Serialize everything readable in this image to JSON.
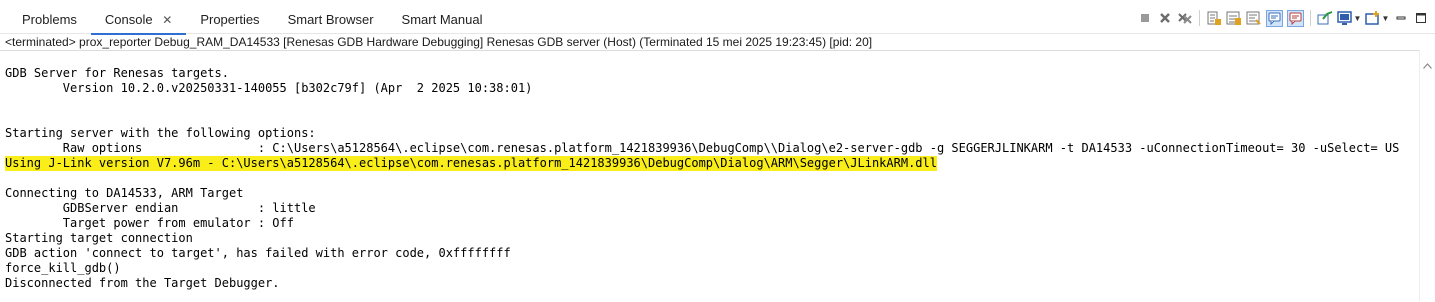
{
  "tabs": [
    {
      "label": "Problems"
    },
    {
      "label": "Console",
      "close": "✕"
    },
    {
      "label": "Properties"
    },
    {
      "label": "Smart Browser"
    },
    {
      "label": "Smart Manual"
    }
  ],
  "toolbar_icons": [
    "terminate-icon",
    "remove-launch-icon",
    "remove-all-terminated-icon",
    "show-console-stdout-icon",
    "scroll-lock-icon",
    "word-wrap-icon",
    "show-on-stdout-change-icon",
    "show-on-stderr-change-icon",
    "pin-console-icon",
    "display-selected-console-icon",
    "open-console-icon",
    "minimize-icon",
    "maximize-icon"
  ],
  "status": "<terminated> prox_reporter Debug_RAM_DA14533 [Renesas GDB Hardware Debugging] Renesas GDB server (Host) (Terminated 15 mei 2025 19:23:45) [pid: 20]",
  "console_lines": [
    {
      "text": "GDB Server for Renesas targets.",
      "highlight": false
    },
    {
      "text": "        Version 10.2.0.v20250331-140055 [b302c79f] (Apr  2 2025 10:38:01)",
      "highlight": false
    },
    {
      "text": "",
      "highlight": false
    },
    {
      "text": "",
      "highlight": false
    },
    {
      "text": "Starting server with the following options:",
      "highlight": false
    },
    {
      "text": "        Raw options                : C:\\Users\\a5128564\\.eclipse\\com.renesas.platform_1421839936\\DebugComp\\\\Dialog\\e2-server-gdb -g SEGGERJLINKARM -t DA14533 -uConnectionTimeout= 30 -uSelect= US",
      "highlight": false
    },
    {
      "text": "Using J-Link version V7.96m - C:\\Users\\a5128564\\.eclipse\\com.renesas.platform_1421839936\\DebugComp\\Dialog\\ARM\\Segger\\JLinkARM.dll",
      "highlight": true
    },
    {
      "text": "",
      "highlight": false
    },
    {
      "text": "Connecting to DA14533, ARM Target",
      "highlight": false
    },
    {
      "text": "        GDBServer endian           : little",
      "highlight": false
    },
    {
      "text": "        Target power from emulator : Off",
      "highlight": false
    },
    {
      "text": "Starting target connection",
      "highlight": false
    },
    {
      "text": "GDB action 'connect to target', has failed with error code, 0xffffffff",
      "highlight": false
    },
    {
      "text": "force_kill_gdb()",
      "highlight": false
    },
    {
      "text": "Disconnected from the Target Debugger.",
      "highlight": false
    }
  ],
  "colors": {
    "highlight": "#f9ee1a",
    "active_tab_underline": "#2f6fd3"
  }
}
